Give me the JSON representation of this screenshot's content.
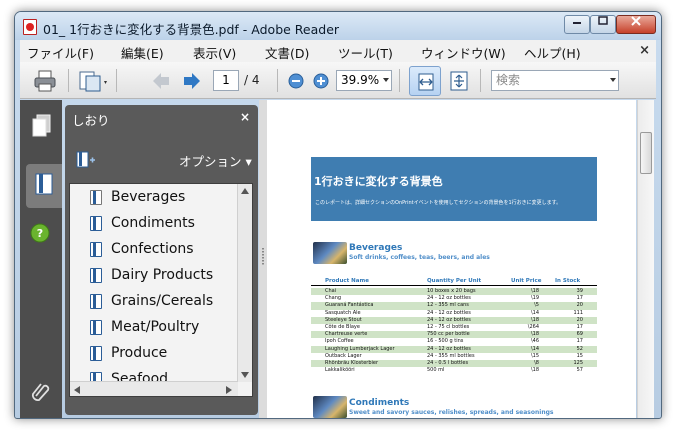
{
  "window": {
    "title": "01_ 1行おきに変化する背景色.pdf - Adobe Reader"
  },
  "menu": [
    "ファイル(F)",
    "編集(E)",
    "表示(V)",
    "文書(D)",
    "ツール(T)",
    "ウィンドウ(W)",
    "ヘルプ(H)"
  ],
  "menu_close": "×",
  "toolbar": {
    "current_page": "1",
    "page_total": "/ 4",
    "zoom": "39.9%",
    "search_placeholder": "検索"
  },
  "panel": {
    "title": "しおり",
    "close": "×",
    "options_label": "オプション ▾"
  },
  "bookmarks": [
    "Beverages",
    "Condiments",
    "Confections",
    "Dairy Products",
    "Grains/Cereals",
    "Meat/Poultry",
    "Produce",
    "Seafood"
  ],
  "pdf": {
    "header_title": "1行おきに変化する背景色",
    "header_subtitle": "このレポートは、詳細セクションのOnPrintイベントを使用してセクションの背景色を1行おきに変更します。",
    "columns": [
      "Product Name",
      "Quantity Per Unit",
      "Unit Price",
      "In Stock"
    ],
    "categories": [
      {
        "name": "Beverages",
        "description": "Soft drinks, coffees, teas, beers, and ales"
      },
      {
        "name": "Condiments",
        "description": "Sweet and savory sauces, relishes, spreads, and seasonings"
      }
    ],
    "rows": [
      [
        "Chai",
        "10 boxes x 20 bags",
        "\\18",
        "39"
      ],
      [
        "Chang",
        "24 - 12 oz bottles",
        "\\19",
        "17"
      ],
      [
        "Guaraná Fantástica",
        "12 - 355 ml cans",
        "\\5",
        "20"
      ],
      [
        "Sasquatch Ale",
        "24 - 12 oz bottles",
        "\\14",
        "111"
      ],
      [
        "Steeleye Stout",
        "24 - 12 oz bottles",
        "\\18",
        "20"
      ],
      [
        "Côte de Blaye",
        "12 - 75 cl bottles",
        "\\264",
        "17"
      ],
      [
        "Chartreuse verte",
        "750 cc per bottle",
        "\\18",
        "69"
      ],
      [
        "Ipoh Coffee",
        "16 - 500 g tins",
        "\\46",
        "17"
      ],
      [
        "Laughing Lumberjack Lager",
        "24 - 12 oz bottles",
        "\\14",
        "52"
      ],
      [
        "Outback Lager",
        "24 - 355 ml bottles",
        "\\15",
        "15"
      ],
      [
        "Rhönbräu Klosterbier",
        "24 - 0.5 l bottles",
        "\\8",
        "125"
      ],
      [
        "Lakkalikööri",
        "500 ml",
        "\\18",
        "57"
      ]
    ]
  },
  "colors": {
    "pdf_header": "#3f7db1",
    "category_text": "#2f78b8",
    "alt_row": "#cfe3c6",
    "panel_bg": "#5a5a5a"
  }
}
